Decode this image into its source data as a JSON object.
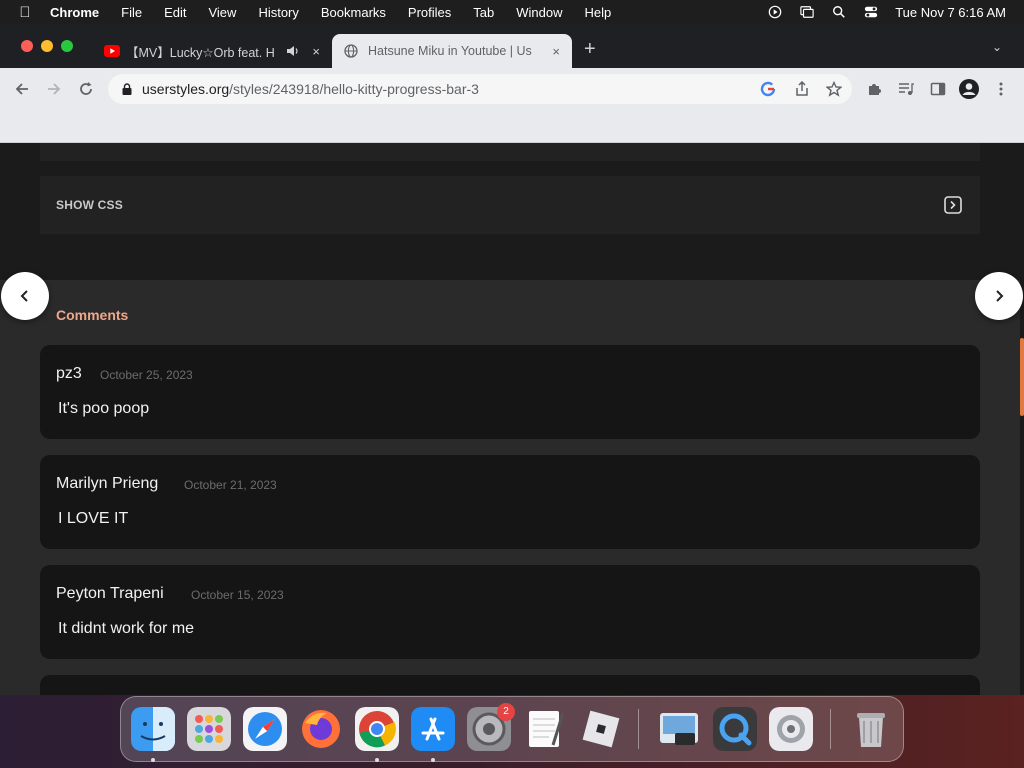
{
  "menubar": {
    "app_name": "Chrome",
    "items": [
      "File",
      "Edit",
      "View",
      "History",
      "Bookmarks",
      "Profiles",
      "Tab",
      "Window",
      "Help"
    ],
    "clock": "Tue Nov 7  6:16 AM"
  },
  "tabs": [
    {
      "title": "【MV】Lucky☆Orb feat. H",
      "icon": "youtube-icon",
      "audio": "speaker-icon",
      "close": "×"
    },
    {
      "title": "Hatsune Miku in Youtube | Us",
      "icon": "globe-icon",
      "close": "×"
    }
  ],
  "new_tab_label": "+",
  "tab_menu_label": "⌄",
  "address_bar": {
    "host": "userstyles.org",
    "path": "/styles/243918/hello-kitty-progress-bar-3"
  },
  "page": {
    "show_css_label": "SHOW CSS",
    "comments_title": "Comments",
    "comments": [
      {
        "author": "pz3",
        "date": "October 25, 2023",
        "body": "It's poo poop"
      },
      {
        "author": "Marilyn Prieng",
        "date": "October 21, 2023",
        "body": "I LOVE IT"
      },
      {
        "author": "Peyton Trapeni",
        "date": "October 15, 2023",
        "body": "It didnt work for me"
      }
    ],
    "prev_label": "‹",
    "next_label": "›"
  },
  "dock": {
    "apps": [
      "Finder",
      "Launchpad",
      "Safari",
      "Firefox",
      "Chrome",
      "App Store",
      "System Preferences",
      "TextEdit",
      "Roblox",
      "Preview",
      "QuickTime Player",
      "Settings",
      "Trash"
    ],
    "system_prefs_badge": "2"
  },
  "colors": {
    "accent": "#f0a68c",
    "page_bg": "#1b1b1b",
    "comment_bg": "#151515"
  }
}
